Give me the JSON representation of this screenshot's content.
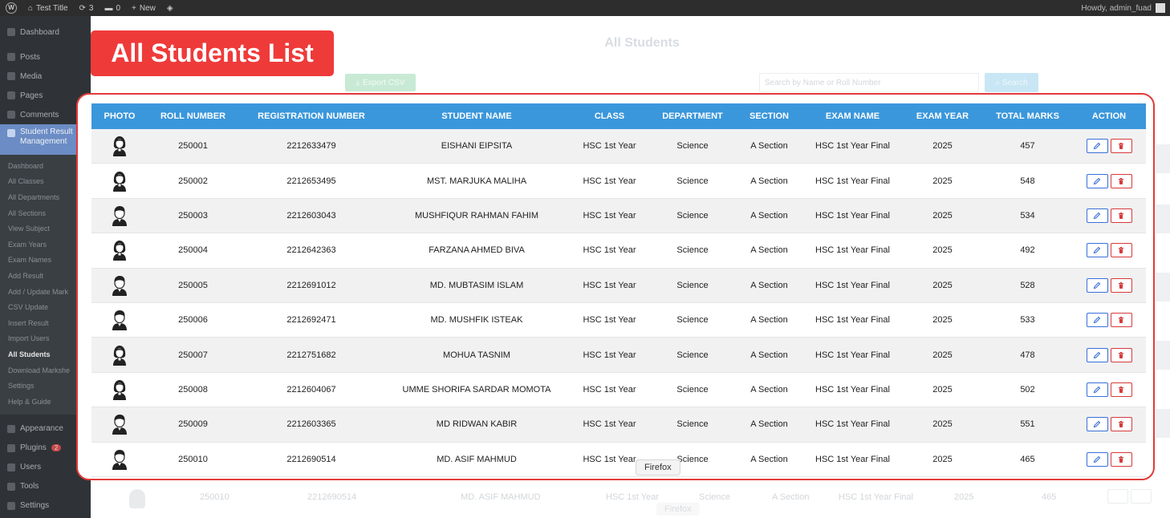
{
  "admin_bar": {
    "site_title": "Test Title",
    "updates_count": "3",
    "comments_count": "0",
    "new_label": "New",
    "greeting": "Howdy, admin_fuad"
  },
  "sidebar": {
    "items_top": [
      {
        "label": "Dashboard",
        "icon": "dashboard-icon"
      },
      {
        "label": "Posts",
        "icon": "pin-icon"
      },
      {
        "label": "Media",
        "icon": "media-icon"
      },
      {
        "label": "Pages",
        "icon": "page-icon"
      },
      {
        "label": "Comments",
        "icon": "comment-icon"
      }
    ],
    "active": {
      "label_line1": "Student Result",
      "label_line2": "Management"
    },
    "sub_items": [
      "Dashboard",
      "All Classes",
      "All Departments",
      "All Sections",
      "View Subject",
      "Exam Years",
      "Exam Names",
      "Add Result",
      "Add / Update Mark",
      "CSV Update",
      "Insert Result",
      "Import Users",
      "All Students",
      "Download Markshe",
      "Settings",
      "Help & Guide"
    ],
    "current_sub": "All Students",
    "items_bottom": [
      {
        "label": "Appearance",
        "icon": "brush-icon"
      },
      {
        "label": "Plugins",
        "icon": "plug-icon",
        "badge": "2"
      },
      {
        "label": "Users",
        "icon": "user-icon"
      },
      {
        "label": "Tools",
        "icon": "wrench-icon"
      },
      {
        "label": "Settings",
        "icon": "settings-icon"
      }
    ]
  },
  "page": {
    "title": "All Students",
    "export_label": "Export CSV",
    "search_placeholder": "Search by Name or Roll Number",
    "search_label": "Search"
  },
  "highlight_label": "All Students List",
  "table": {
    "headers": [
      "PHOTO",
      "ROLL NUMBER",
      "REGISTRATION NUMBER",
      "STUDENT NAME",
      "CLASS",
      "DEPARTMENT",
      "SECTION",
      "EXAM NAME",
      "EXAM YEAR",
      "TOTAL MARKS",
      "ACTION"
    ],
    "rows": [
      {
        "avatar": "female",
        "roll": "250001",
        "reg": "2212633479",
        "name": "EISHANI EIPSITA",
        "class": "HSC 1st Year",
        "dept": "Science",
        "section": "A Section",
        "exam": "HSC 1st Year Final",
        "year": "2025",
        "marks": "457"
      },
      {
        "avatar": "female",
        "roll": "250002",
        "reg": "2212653495",
        "name": "MST. MARJUKA MALIHA",
        "class": "HSC 1st Year",
        "dept": "Science",
        "section": "A Section",
        "exam": "HSC 1st Year Final",
        "year": "2025",
        "marks": "548"
      },
      {
        "avatar": "male",
        "roll": "250003",
        "reg": "2212603043",
        "name": "MUSHFIQUR RAHMAN FAHIM",
        "class": "HSC 1st Year",
        "dept": "Science",
        "section": "A Section",
        "exam": "HSC 1st Year Final",
        "year": "2025",
        "marks": "534"
      },
      {
        "avatar": "female",
        "roll": "250004",
        "reg": "2212642363",
        "name": "FARZANA AHMED BIVA",
        "class": "HSC 1st Year",
        "dept": "Science",
        "section": "A Section",
        "exam": "HSC 1st Year Final",
        "year": "2025",
        "marks": "492"
      },
      {
        "avatar": "male",
        "roll": "250005",
        "reg": "2212691012",
        "name": "MD. MUBTASIM ISLAM",
        "class": "HSC 1st Year",
        "dept": "Science",
        "section": "A Section",
        "exam": "HSC 1st Year Final",
        "year": "2025",
        "marks": "528"
      },
      {
        "avatar": "male",
        "roll": "250006",
        "reg": "2212692471",
        "name": "MD. MUSHFIK ISTEAK",
        "class": "HSC 1st Year",
        "dept": "Science",
        "section": "A Section",
        "exam": "HSC 1st Year Final",
        "year": "2025",
        "marks": "533"
      },
      {
        "avatar": "female",
        "roll": "250007",
        "reg": "2212751682",
        "name": "MOHUA TASNIM",
        "class": "HSC 1st Year",
        "dept": "Science",
        "section": "A Section",
        "exam": "HSC 1st Year Final",
        "year": "2025",
        "marks": "478"
      },
      {
        "avatar": "female",
        "roll": "250008",
        "reg": "2212604067",
        "name": "UMME SHORIFA SARDAR MOMOTA",
        "class": "HSC 1st Year",
        "dept": "Science",
        "section": "A Section",
        "exam": "HSC 1st Year Final",
        "year": "2025",
        "marks": "502"
      },
      {
        "avatar": "male",
        "roll": "250009",
        "reg": "2212603365",
        "name": "MD RIDWAN KABIR",
        "class": "HSC 1st Year",
        "dept": "Science",
        "section": "A Section",
        "exam": "HSC 1st Year Final",
        "year": "2025",
        "marks": "551"
      },
      {
        "avatar": "male",
        "roll": "250010",
        "reg": "2212690514",
        "name": "MD. ASIF MAHMUD",
        "class": "HSC 1st Year",
        "dept": "Science",
        "section": "A Section",
        "exam": "HSC 1st Year Final",
        "year": "2025",
        "marks": "465"
      }
    ]
  },
  "ghost_row": {
    "roll": "250010",
    "reg": "2212690514",
    "name": "MD. ASIF MAHMUD",
    "class": "HSC 1st Year",
    "dept": "Science",
    "section": "A Section",
    "exam": "HSC 1st Year Final",
    "year": "2025",
    "marks": "465"
  },
  "tooltip": "Firefox",
  "colors": {
    "header_blue": "#3b97db",
    "highlight_red": "#ef3a3a",
    "edit_blue": "#3a6fd8",
    "delete_red": "#d63a3a"
  }
}
